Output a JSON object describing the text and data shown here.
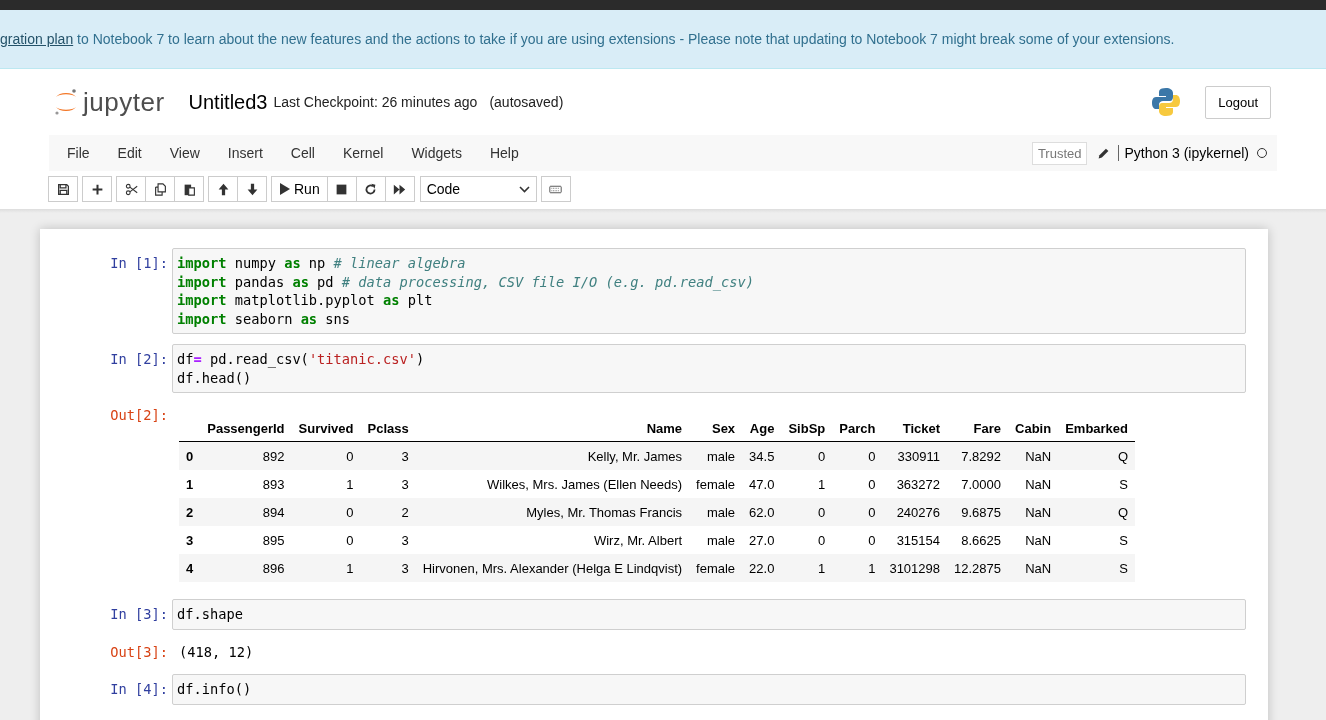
{
  "banner": {
    "link": "gration plan",
    "text": " to Notebook 7 to learn about the new features and the actions to take if you are using extensions - Please note that updating to Notebook 7 might break some of your extensions."
  },
  "header": {
    "logo_text": "jupyter",
    "notebook_title": "Untitled3",
    "checkpoint": "Last Checkpoint: 26 minutes ago",
    "autosave": "(autosaved)",
    "logout": "Logout"
  },
  "menu": [
    "File",
    "Edit",
    "View",
    "Insert",
    "Cell",
    "Kernel",
    "Widgets",
    "Help"
  ],
  "kernel": {
    "trusted": "Trusted",
    "name": "Python 3 (ipykernel)",
    "busy": false
  },
  "toolbar": {
    "run": "Run",
    "cell_type": "Code"
  },
  "cells": [
    {
      "prompt": "In [1]:",
      "code": [
        [
          {
            "text": "import",
            "kind": "kw"
          },
          {
            "text": " numpy ",
            "kind": "plain"
          },
          {
            "text": "as",
            "kind": "kw"
          },
          {
            "text": " np ",
            "kind": "plain"
          },
          {
            "text": "# linear algebra",
            "kind": "comment"
          }
        ],
        [
          {
            "text": "import",
            "kind": "kw"
          },
          {
            "text": " pandas ",
            "kind": "plain"
          },
          {
            "text": "as",
            "kind": "kw"
          },
          {
            "text": " pd ",
            "kind": "plain"
          },
          {
            "text": "# data processing, CSV file I/O (e.g. pd.read_csv)",
            "kind": "comment"
          }
        ],
        [
          {
            "text": "import",
            "kind": "kw"
          },
          {
            "text": " matplotlib.pyplot ",
            "kind": "plain"
          },
          {
            "text": "as",
            "kind": "kw"
          },
          {
            "text": " plt",
            "kind": "plain"
          }
        ],
        [
          {
            "text": "import",
            "kind": "kw"
          },
          {
            "text": " seaborn ",
            "kind": "plain"
          },
          {
            "text": "as",
            "kind": "kw"
          },
          {
            "text": " sns",
            "kind": "plain"
          }
        ]
      ]
    },
    {
      "prompt": "In [2]:",
      "code": [
        [
          {
            "text": "df",
            "kind": "plain"
          },
          {
            "text": "=",
            "kind": "op"
          },
          {
            "text": " pd.read_csv(",
            "kind": "plain"
          },
          {
            "text": "'titanic.csv'",
            "kind": "string"
          },
          {
            "text": ")",
            "kind": "plain"
          }
        ],
        [
          {
            "text": "df.head()",
            "kind": "plain"
          }
        ]
      ],
      "output": {
        "prompt": "Out[2]:",
        "kind": "table",
        "columns": [
          "",
          "PassengerId",
          "Survived",
          "Pclass",
          "Name",
          "Sex",
          "Age",
          "SibSp",
          "Parch",
          "Ticket",
          "Fare",
          "Cabin",
          "Embarked"
        ],
        "rows": [
          [
            "0",
            "892",
            "0",
            "3",
            "Kelly, Mr. James",
            "male",
            "34.5",
            "0",
            "0",
            "330911",
            "7.8292",
            "NaN",
            "Q"
          ],
          [
            "1",
            "893",
            "1",
            "3",
            "Wilkes, Mrs. James (Ellen Needs)",
            "female",
            "47.0",
            "1",
            "0",
            "363272",
            "7.0000",
            "NaN",
            "S"
          ],
          [
            "2",
            "894",
            "0",
            "2",
            "Myles, Mr. Thomas Francis",
            "male",
            "62.0",
            "0",
            "0",
            "240276",
            "9.6875",
            "NaN",
            "Q"
          ],
          [
            "3",
            "895",
            "0",
            "3",
            "Wirz, Mr. Albert",
            "male",
            "27.0",
            "0",
            "0",
            "315154",
            "8.6625",
            "NaN",
            "S"
          ],
          [
            "4",
            "896",
            "1",
            "3",
            "Hirvonen, Mrs. Alexander (Helga E Lindqvist)",
            "female",
            "22.0",
            "1",
            "1",
            "3101298",
            "12.2875",
            "NaN",
            "S"
          ]
        ]
      }
    },
    {
      "prompt": "In [3]:",
      "code": [
        [
          {
            "text": "df.shape",
            "kind": "plain"
          }
        ]
      ],
      "output": {
        "prompt": "Out[3]:",
        "kind": "text",
        "text": "(418, 12)"
      }
    },
    {
      "prompt": "In [4]:",
      "code": [
        [
          {
            "text": "df.info()",
            "kind": "plain"
          }
        ]
      ]
    }
  ]
}
